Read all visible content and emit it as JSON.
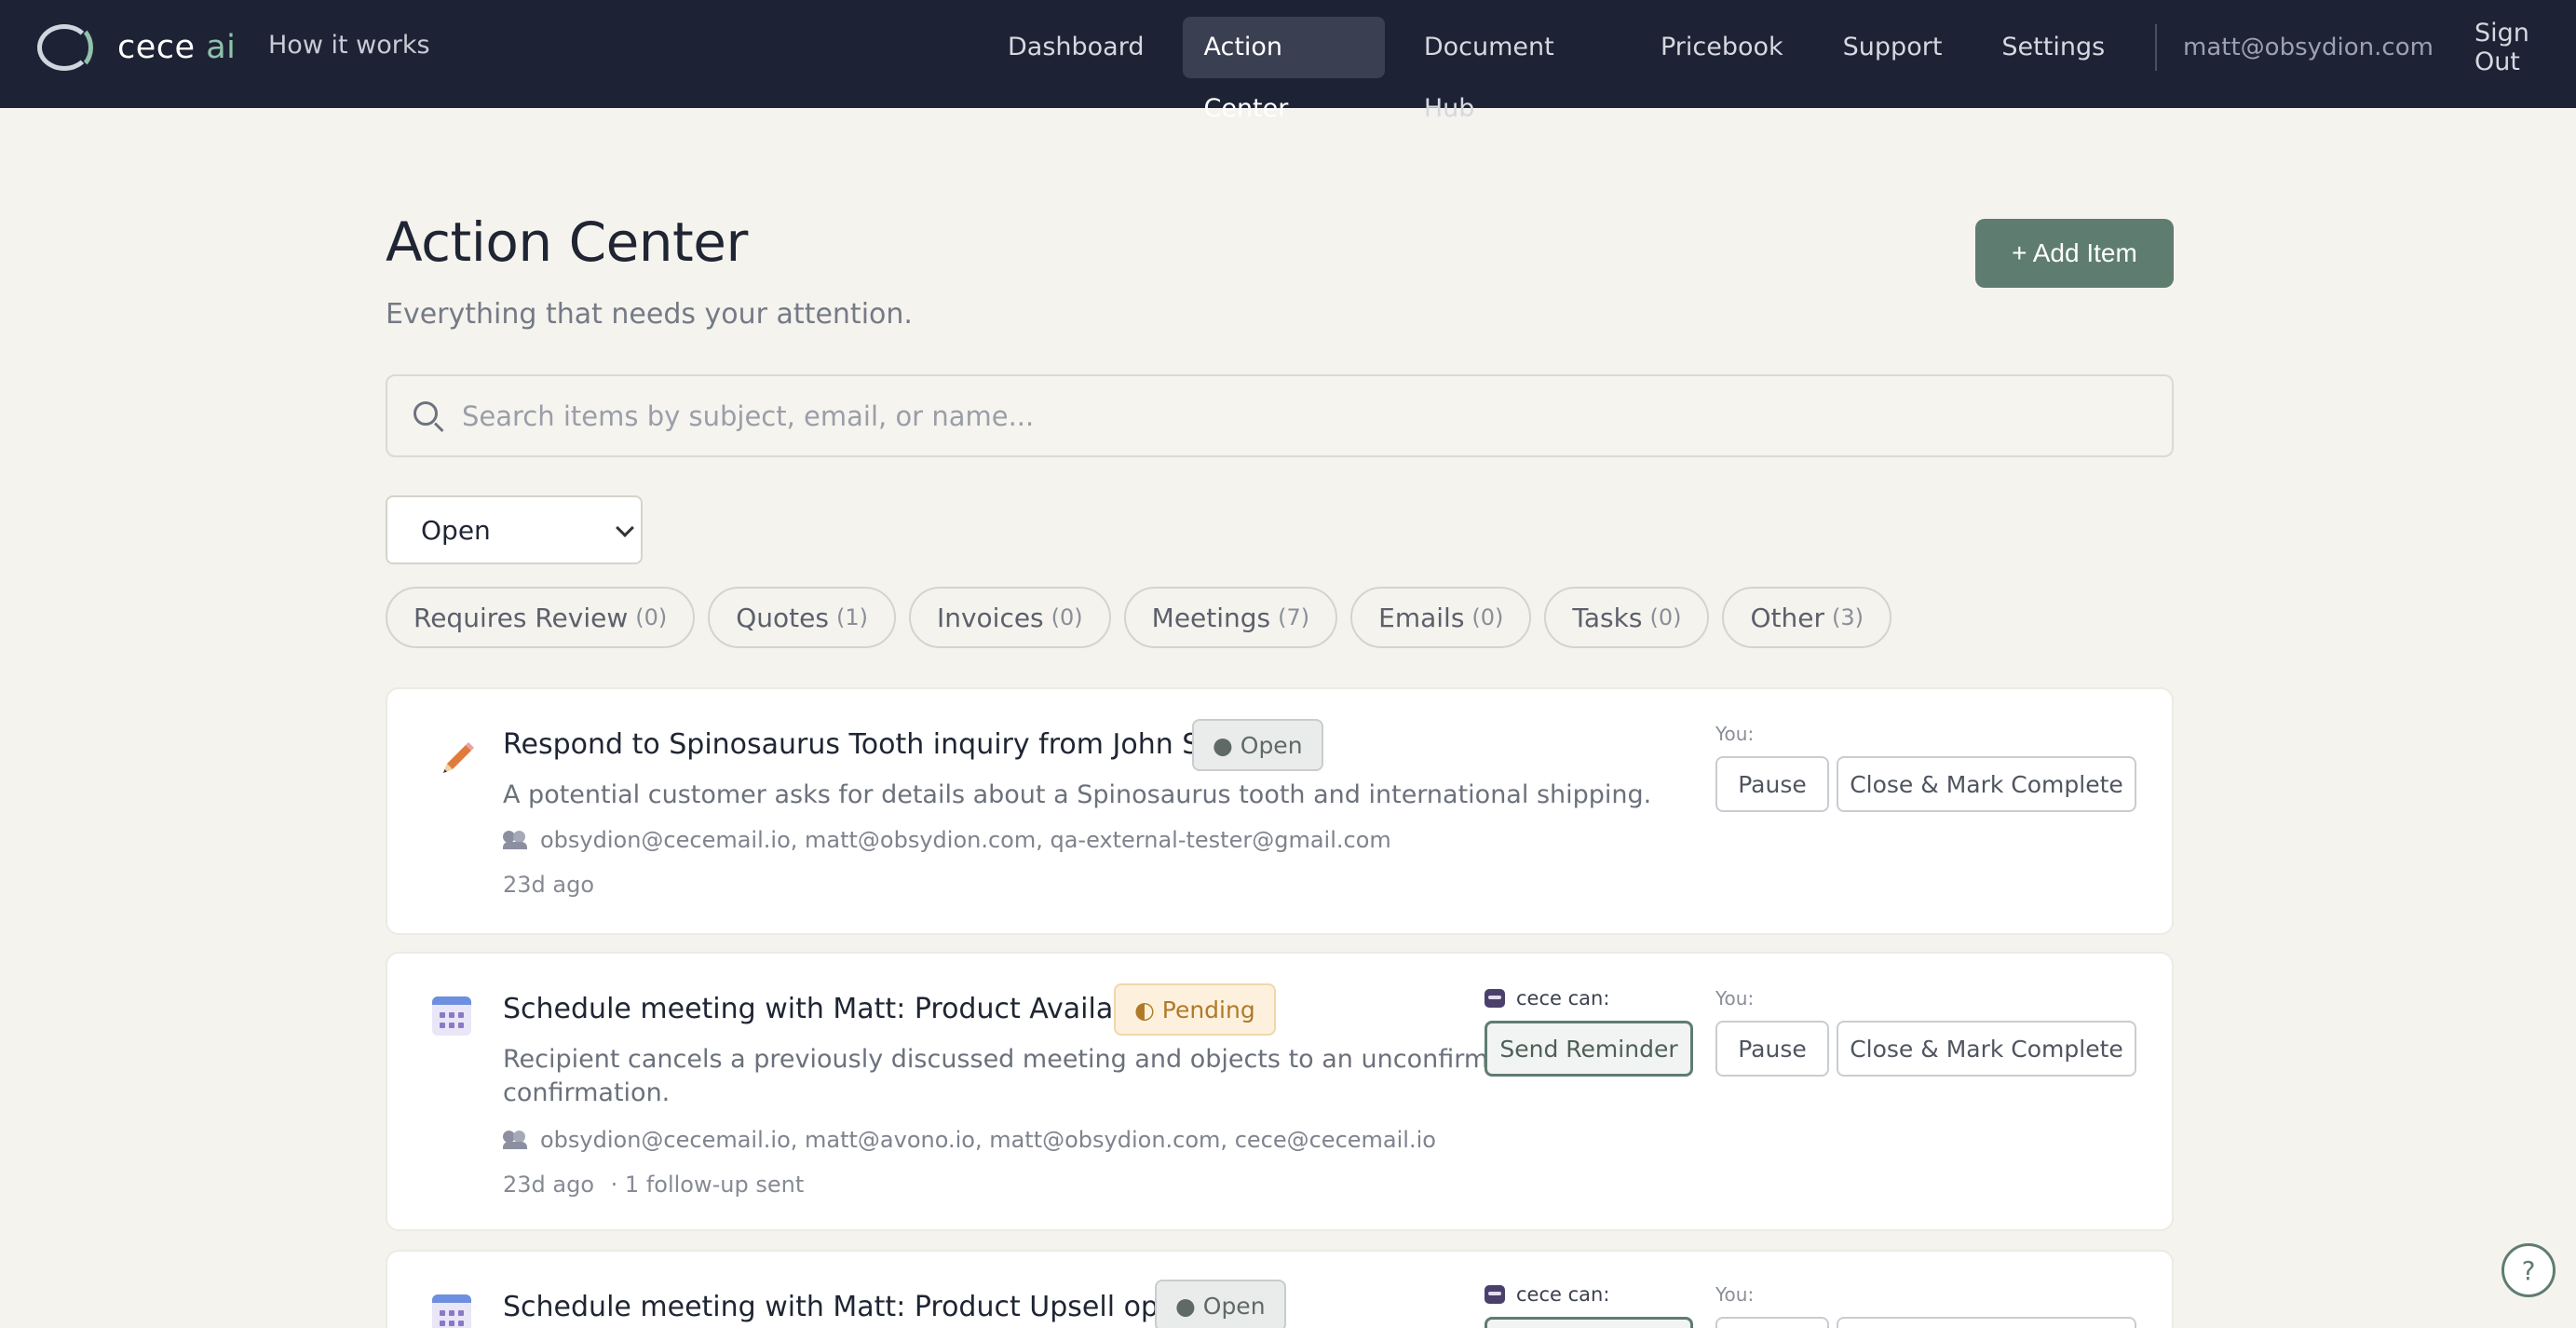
{
  "nav": {
    "brand_main": "cece",
    "brand_accent": "ai",
    "how_it_works": "How it works",
    "links": [
      "Dashboard",
      "Action Center",
      "Document Hub",
      "Pricebook",
      "Support",
      "Settings"
    ],
    "active_link": "Action Center",
    "user_email": "matt@obsydion.com",
    "sign_out": "Sign Out"
  },
  "header": {
    "title": "Action Center",
    "subtitle": "Everything that needs your attention.",
    "add_button": "+ Add Item"
  },
  "search": {
    "placeholder": "Search items by subject, email, or name..."
  },
  "status_filter": {
    "selected": "Open"
  },
  "categories": [
    {
      "label": "Requires Review",
      "count": "(0)"
    },
    {
      "label": "Quotes",
      "count": "(1)"
    },
    {
      "label": "Invoices",
      "count": "(0)"
    },
    {
      "label": "Meetings",
      "count": "(7)"
    },
    {
      "label": "Emails",
      "count": "(0)"
    },
    {
      "label": "Tasks",
      "count": "(0)"
    },
    {
      "label": "Other",
      "count": "(3)"
    }
  ],
  "items": [
    {
      "icon": "pencil-icon",
      "title": "Respond to Spinosaurus Tooth inquiry from John Smith",
      "status": "● Open",
      "description": "A potential customer asks for details about a Spinosaurus tooth and international shipping.",
      "participants": "obsydion@cecemail.io, matt@obsydion.com, qa-external-tester@gmail.com",
      "time": "23d ago",
      "you_label": "You:",
      "buttons": [
        "Pause",
        "Close & Mark Complete"
      ]
    },
    {
      "icon": "calendar-icon",
      "title": "Schedule meeting with Matt: Product Availability",
      "status": "◐ Pending",
      "description_line1": "Recipient cancels a previously discussed meeting and objects to an unconfirmed",
      "description_line2": "confirmation.",
      "participants": "obsydion@cecemail.io, matt@avono.io, matt@obsydion.com, cece@cecemail.io",
      "time": "23d ago",
      "followups": "· 1 follow-up sent",
      "cece_label": "cece can:",
      "cece_button": "Send Reminder",
      "you_label": "You:",
      "buttons": [
        "Pause",
        "Close & Mark Complete"
      ]
    },
    {
      "icon": "calendar-icon",
      "title": "Schedule meeting with Matt: Product Upsell options",
      "status": "● Open",
      "cece_label": "cece can:",
      "you_label": "You:"
    }
  ],
  "help": "?",
  "colors": {
    "nav_bg": "#1e2235",
    "page_bg": "#f5f3ee",
    "accent": "#5e7d70",
    "brand_accent": "#8fc3aa"
  }
}
